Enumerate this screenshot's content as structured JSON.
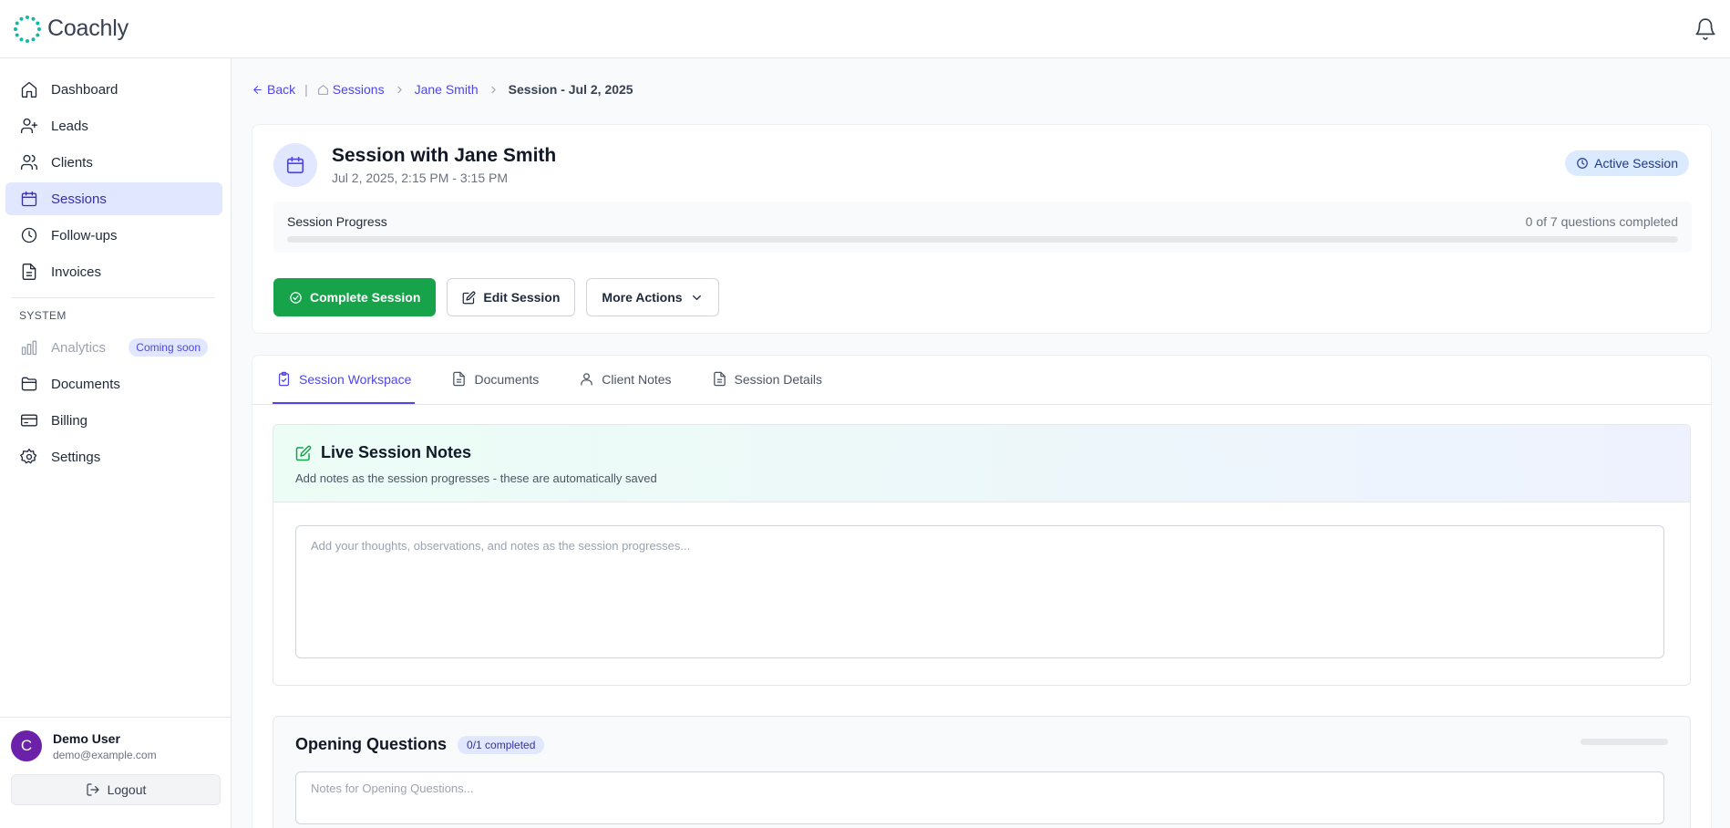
{
  "app": {
    "name": "Coachly"
  },
  "sidebar": {
    "items": [
      {
        "label": "Dashboard"
      },
      {
        "label": "Leads"
      },
      {
        "label": "Clients"
      },
      {
        "label": "Sessions"
      },
      {
        "label": "Follow-ups"
      },
      {
        "label": "Invoices"
      }
    ],
    "section_label": "SYSTEM",
    "system_items": [
      {
        "label": "Analytics",
        "badge": "Coming soon"
      },
      {
        "label": "Documents"
      },
      {
        "label": "Billing"
      },
      {
        "label": "Settings"
      }
    ]
  },
  "user": {
    "initial": "C",
    "name": "Demo User",
    "email": "demo@example.com",
    "logout_label": "Logout"
  },
  "breadcrumb": {
    "back": "Back",
    "sessions": "Sessions",
    "client": "Jane Smith",
    "current": "Session - Jul 2, 2025"
  },
  "session": {
    "title": "Session with Jane Smith",
    "time": "Jul 2, 2025, 2:15 PM - 3:15 PM",
    "status": "Active Session",
    "progress_label": "Session Progress",
    "progress_count": "0 of 7 questions completed",
    "progress_fraction": 0
  },
  "actions": {
    "complete": "Complete Session",
    "edit": "Edit Session",
    "more": "More Actions"
  },
  "tabs": [
    {
      "label": "Session Workspace"
    },
    {
      "label": "Documents"
    },
    {
      "label": "Client Notes"
    },
    {
      "label": "Session Details"
    }
  ],
  "live_notes": {
    "title": "Live Session Notes",
    "subtitle": "Add notes as the session progresses - these are automatically saved",
    "placeholder": "Add your thoughts, observations, and notes as the session progresses..."
  },
  "opening_questions": {
    "title": "Opening Questions",
    "badge": "0/1 completed",
    "placeholder": "Notes for Opening Questions...",
    "progress_fraction": 0
  },
  "colors": {
    "accent": "#4f46e5",
    "success": "#16a34a",
    "active_bg": "#e0e7ff",
    "avatar": "#6b21a8"
  }
}
